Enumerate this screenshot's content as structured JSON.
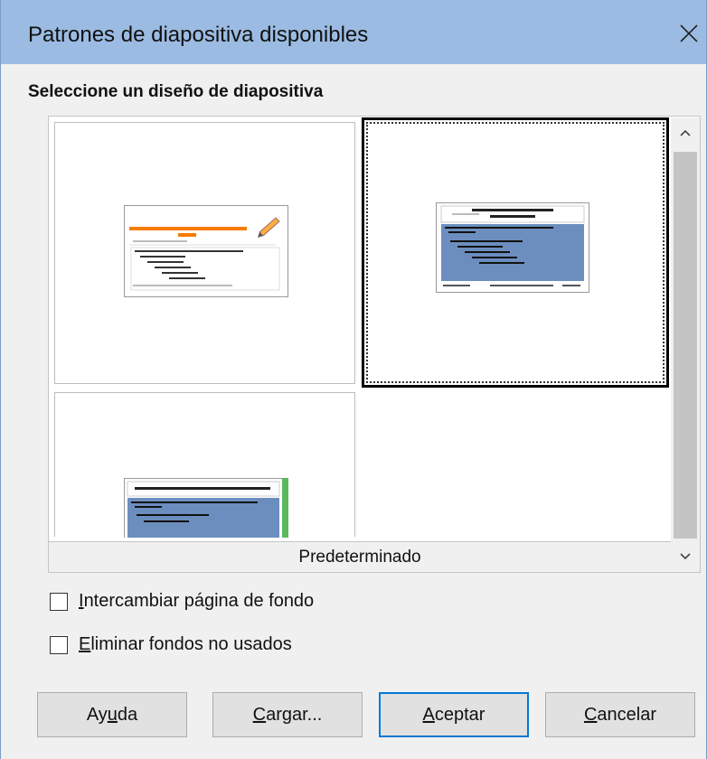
{
  "dialog": {
    "title": "Patrones de diapositiva disponibles",
    "close_icon": "close-icon"
  },
  "section_heading": "Seleccione un diseño de diapositiva",
  "slide_designs": {
    "selected_index": 1,
    "caption": "Predeterminado"
  },
  "checkboxes": [
    {
      "label_mnemonic": "I",
      "label_rest": "ntercambiar página de fondo",
      "checked": false
    },
    {
      "label_mnemonic": "E",
      "label_rest": "liminar fondos no usados",
      "checked": false
    }
  ],
  "buttons": {
    "help": {
      "pre": "Ay",
      "mnemonic": "u",
      "post": "da"
    },
    "load": {
      "pre": "",
      "mnemonic": "C",
      "post": "argar..."
    },
    "ok": {
      "pre": "",
      "mnemonic": "A",
      "post": "ceptar"
    },
    "cancel": {
      "pre": "",
      "mnemonic": "C",
      "post": "ancelar"
    }
  },
  "colors": {
    "titlebar": "#9bbbe2",
    "selection_border": "#000000",
    "default_button_border": "#0078d7",
    "slide_body_blue": "#6c8ebf",
    "slide_title_orange": "#f57c00"
  }
}
